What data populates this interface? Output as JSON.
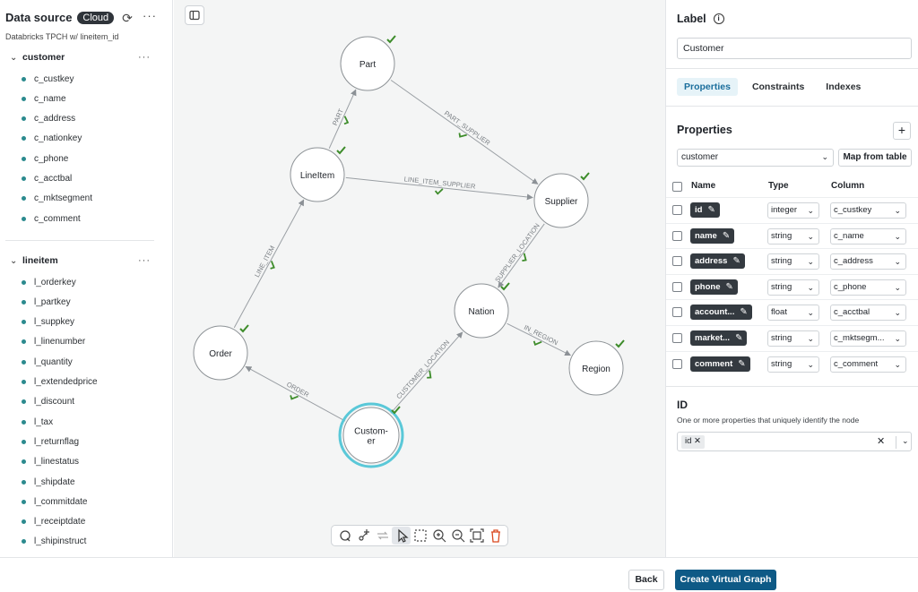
{
  "sidebar": {
    "title": "Data source",
    "badge": "Cloud",
    "subtitle": "Databricks TPCH w/ lineitem_id",
    "groups": [
      {
        "name": "customer",
        "fields": [
          "c_custkey",
          "c_name",
          "c_address",
          "c_nationkey",
          "c_phone",
          "c_acctbal",
          "c_mktsegment",
          "c_comment"
        ]
      },
      {
        "name": "lineitem",
        "fields": [
          "l_orderkey",
          "l_partkey",
          "l_suppkey",
          "l_linenumber",
          "l_quantity",
          "l_extendedprice",
          "l_discount",
          "l_tax",
          "l_returnflag",
          "l_linestatus",
          "l_shipdate",
          "l_commitdate",
          "l_receiptdate",
          "l_shipinstruct"
        ]
      }
    ]
  },
  "graph": {
    "nodes": [
      {
        "id": "part",
        "label": "Part"
      },
      {
        "id": "lineitem",
        "label": "LineItem"
      },
      {
        "id": "supplier",
        "label": "Supplier"
      },
      {
        "id": "nation",
        "label": "Nation"
      },
      {
        "id": "order",
        "label": "Order"
      },
      {
        "id": "region",
        "label": "Region"
      },
      {
        "id": "customer",
        "label": "Custom-\ner",
        "selected": true
      }
    ],
    "edges": [
      {
        "from": "lineitem",
        "to": "part",
        "label": "PART"
      },
      {
        "from": "part",
        "to": "supplier",
        "label": "PART_SUPPLIER"
      },
      {
        "from": "lineitem",
        "to": "supplier",
        "label": "LINE_ITEM_SUPPLIER"
      },
      {
        "from": "supplier",
        "to": "nation",
        "label": "SUPPLIER_LOCATION"
      },
      {
        "from": "order",
        "to": "lineitem",
        "label": "LINE_ITEM"
      },
      {
        "from": "nation",
        "to": "region",
        "label": "IN_REGION"
      },
      {
        "from": "customer",
        "to": "nation",
        "label": "CUSTOMER_LOCATION"
      },
      {
        "from": "customer",
        "to": "order",
        "label": "ORDER"
      }
    ],
    "accent_color": "#5ac8d8",
    "check_color": "#3d8c2a"
  },
  "toolbar": {
    "tools": [
      "lasso-select-icon",
      "add-node-icon",
      "swap-icon",
      "pointer-icon",
      "box-select-icon",
      "zoom-in-icon",
      "zoom-out-icon",
      "fit-view-icon",
      "delete-icon"
    ]
  },
  "panel": {
    "label_heading": "Label",
    "label_value": "Customer",
    "tabs": [
      "Properties",
      "Constraints",
      "Indexes"
    ],
    "properties_heading": "Properties",
    "source_table": "customer",
    "map_button": "Map from table",
    "columns": {
      "name": "Name",
      "type": "Type",
      "column": "Column"
    },
    "rows": [
      {
        "name": "id",
        "type": "integer",
        "column": "c_custkey"
      },
      {
        "name": "name",
        "type": "string",
        "column": "c_name"
      },
      {
        "name": "address",
        "type": "string",
        "column": "c_address"
      },
      {
        "name": "phone",
        "type": "string",
        "column": "c_phone"
      },
      {
        "name": "account...",
        "type": "float",
        "column": "c_acctbal"
      },
      {
        "name": "market...",
        "type": "string",
        "column": "c_mktsegm..."
      },
      {
        "name": "comment",
        "type": "string",
        "column": "c_comment"
      }
    ],
    "id_heading": "ID",
    "id_description": "One or more properties that uniquely identify the node",
    "id_value": "id"
  },
  "footer": {
    "back": "Back",
    "create": "Create Virtual Graph"
  }
}
